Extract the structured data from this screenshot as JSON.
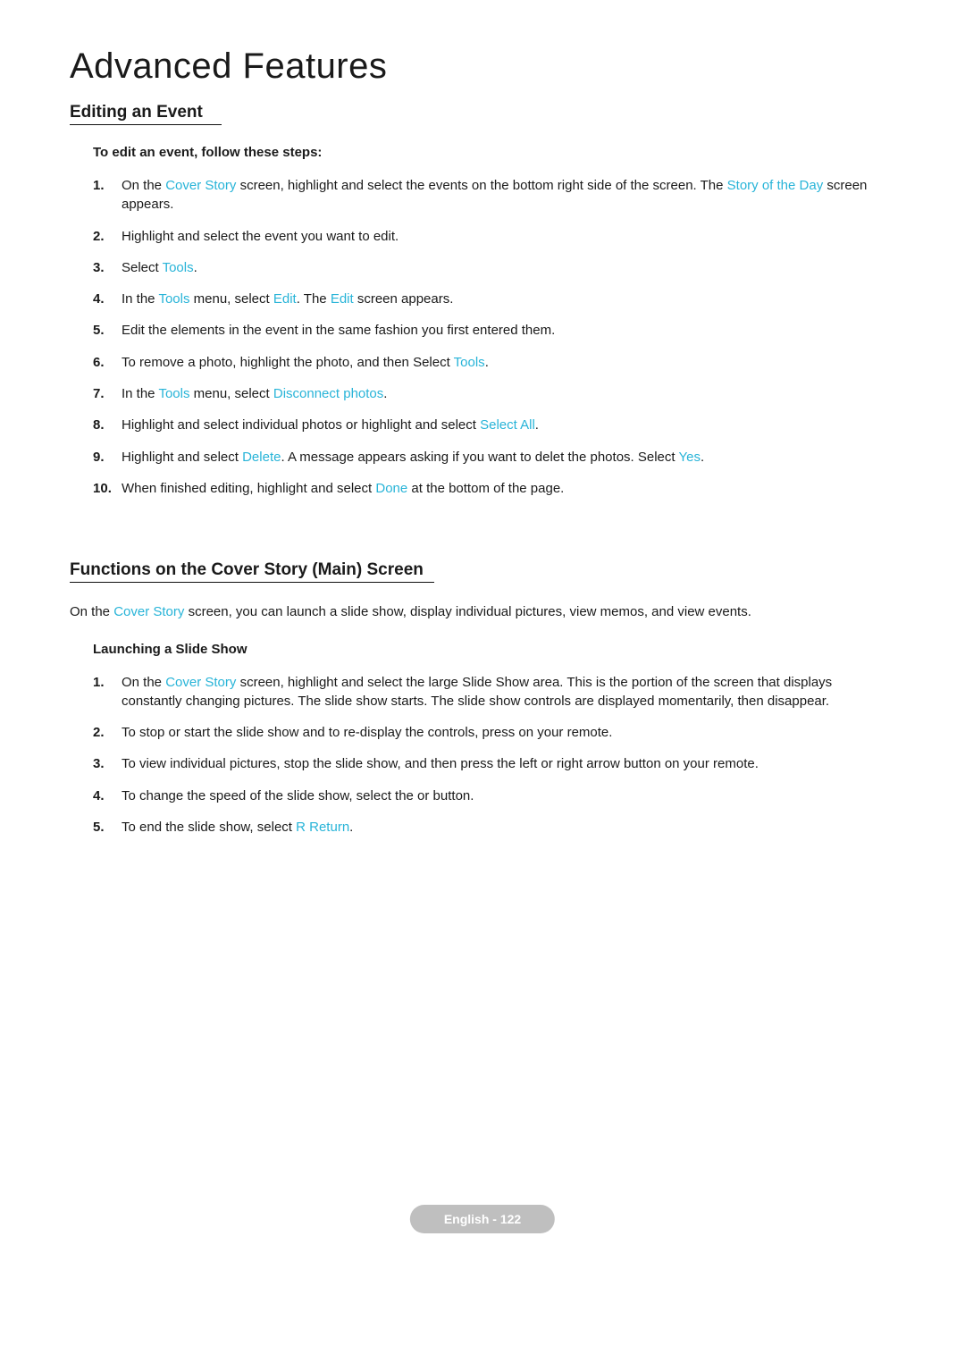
{
  "title": "Advanced Features",
  "editing": {
    "heading": "Editing an Event",
    "intro": "To edit an event, follow these steps:",
    "steps": {
      "s1a": "On the ",
      "s1_cover": "Cover Story",
      "s1b": " screen, highlight and select the events on the bottom right side of the screen. The ",
      "s1_sotd": "Story of the Day",
      "s1c": " screen appears.",
      "s2": "Highlight and select the event you want to edit.",
      "s3a": "Select ",
      "s3_tools": "Tools",
      "s3b": ".",
      "s4a": "In the ",
      "s4_tools": "Tools",
      "s4b": " menu, select ",
      "s4_edit": "Edit",
      "s4c": ". The ",
      "s4_edit2": "Edit",
      "s4d": " screen appears.",
      "s5": "Edit the elements in the event in the same fashion you first entered them.",
      "s6a": "To remove a photo, highlight the photo, and then Select ",
      "s6_tools": "Tools",
      "s6b": ".",
      "s7a": "In the ",
      "s7_tools": "Tools",
      "s7b": " menu, select ",
      "s7_disc": "Disconnect photos",
      "s7c": ".",
      "s8a": "Highlight and select individual photos or highlight and select ",
      "s8_sel": "Select All",
      "s8b": ".",
      "s9a": "Highlight and select ",
      "s9_del": "Delete",
      "s9b": ". A message appears asking if you want to delet the photos. Select ",
      "s9_yes": "Yes",
      "s9c": ".",
      "s10a": "When finished editing, highlight and select ",
      "s10_done": "Done",
      "s10b": " at the bottom of the page."
    }
  },
  "functions": {
    "heading": "Functions on the Cover Story (Main) Screen",
    "intro_a": "On the ",
    "intro_link": "Cover Story",
    "intro_b": " screen, you can launch a slide show, display individual pictures, view memos, and view events.",
    "launch_heading": "Launching a Slide Show",
    "steps": {
      "s1a": "On the ",
      "s1_link": "Cover Story",
      "s1b": " screen, highlight and select the large Slide Show area. This is the portion of the screen that displays constantly changing pictures. The slide show starts. The slide show controls are displayed momentarily, then disappear.",
      "s2": "To stop or start the slide show and to re-display the controls, press  on your remote.",
      "s3": "To view individual pictures, stop the slide show, and then press the left or right arrow button on your remote.",
      "s4": "To change the speed of the slide show, select the   or   button.",
      "s5a": "To end the slide show, select ",
      "s5_r": "R",
      "s5_ret": " Return",
      "s5b": "."
    }
  },
  "footer": "English - 122"
}
